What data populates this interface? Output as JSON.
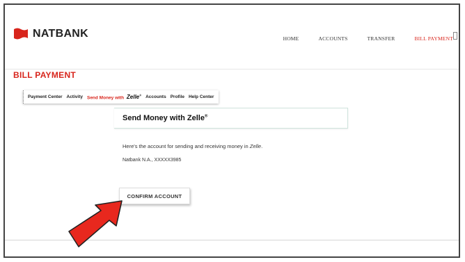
{
  "header": {
    "brand": "NATBANK",
    "nav": [
      "HOME",
      "ACCOUNTS",
      "TRANSFER",
      "BILL PAYMENT"
    ]
  },
  "page_title": "BILL PAYMENT",
  "subnav": {
    "payment_center": "Payment Center",
    "activity": "Activity",
    "send_money": "Send Money with",
    "zelle": "Zelle",
    "accounts": "Accounts",
    "profile": "Profile",
    "help_center": "Help Center"
  },
  "card": {
    "title": "Send Money with Zelle",
    "title_mark": "®",
    "description_prefix": "Here's the account for sending and receiving money in ",
    "description_brand": "Zelle",
    "description_suffix": ".",
    "account_text": "Natbank N.A., XXXXX3985",
    "confirm_label": "CONFIRM ACCOUNT"
  },
  "colors": {
    "accent": "#d8251c",
    "arrow": "#e8281e"
  }
}
